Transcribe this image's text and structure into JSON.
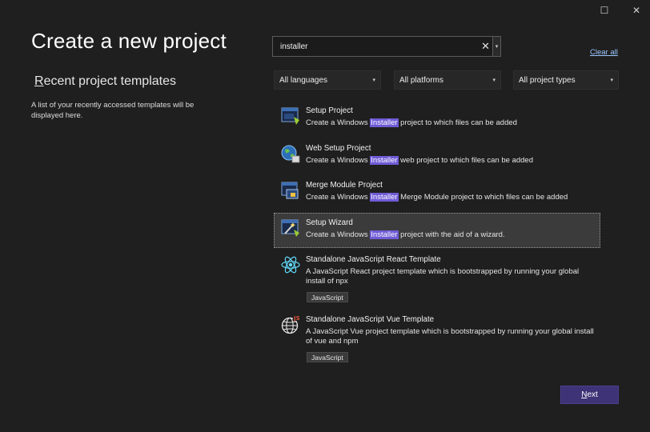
{
  "window": {
    "maximize_icon": "maximize-icon",
    "close_icon": "close-icon",
    "maximize_glyph": "☐",
    "close_glyph": "✕"
  },
  "page": {
    "title": "Create a new project"
  },
  "recent": {
    "title_first": "R",
    "title_rest": "ecent project templates",
    "description": "A list of your recently accessed templates will be displayed here."
  },
  "search": {
    "value": "installer",
    "clear_glyph": "✕",
    "dropdown_glyph": "▾"
  },
  "clear_all": "Clear all",
  "filters": [
    {
      "label": "All languages",
      "caret": "▾"
    },
    {
      "label": "All platforms",
      "caret": "▾"
    },
    {
      "label": "All project types",
      "caret": "▾"
    }
  ],
  "highlight_color": "#6f5bd6",
  "templates": [
    {
      "name": "Setup Project",
      "icon": "setup-project-icon",
      "desc_before": "Create a Windows ",
      "desc_highlight": "Installer",
      "desc_after": " project to which files can be added",
      "selected": false
    },
    {
      "name": "Web Setup Project",
      "icon": "web-setup-icon",
      "desc_before": "Create a Windows ",
      "desc_highlight": "Installer",
      "desc_after": " web project to which files can be added",
      "selected": false
    },
    {
      "name": "Merge Module Project",
      "icon": "merge-module-icon",
      "desc_before": "Create a Windows ",
      "desc_highlight": "Installer",
      "desc_after": " Merge Module project to which files can be added",
      "selected": false
    },
    {
      "name": "Setup Wizard",
      "icon": "setup-wizard-icon",
      "desc_before": "Create a Windows ",
      "desc_highlight": "Installer",
      "desc_after": " project with the aid of a wizard.",
      "selected": true
    },
    {
      "name": "Standalone JavaScript React Template",
      "icon": "react-icon",
      "desc": "A JavaScript React project template which is bootstrapped by running your global install of npx",
      "tag": "JavaScript"
    },
    {
      "name": "Standalone JavaScript Vue Template",
      "icon": "vue-js-globe-icon",
      "desc": "A JavaScript Vue project template which is bootstrapped by running your global install of vue and npm",
      "tag": "JavaScript",
      "badge": "JS"
    }
  ],
  "next_button": {
    "first": "N",
    "rest": "ext"
  }
}
